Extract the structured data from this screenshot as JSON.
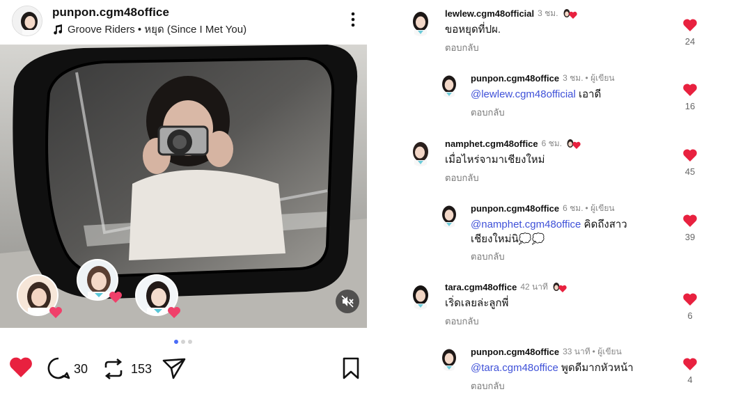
{
  "post": {
    "username": "punpon.cgm48office",
    "music": "Groove Riders • หยุด (Since I Met You)",
    "icons": {
      "music": "music-note-icon",
      "more": "more-vertical-icon",
      "mute": "muted-speaker-icon",
      "like": "heart-filled-icon",
      "comment": "comment-bubble-icon",
      "repost": "repost-icon",
      "share": "paper-plane-icon",
      "save": "bookmark-icon"
    },
    "carousel": {
      "count": 3,
      "active_index": 0
    },
    "like_state": "liked",
    "comment_count": "30",
    "repost_count": "153",
    "colors": {
      "like": "#e8213f",
      "mention": "#3f51d8",
      "dot_active": "#4a6cf7",
      "creator_heart": "#e8213f"
    }
  },
  "comments": [
    {
      "username": "lewlew.cgm48official",
      "time": "3 ชม.",
      "creator_liked": true,
      "text": "ขอหยุดที่ปผ.",
      "reply_label": "ตอบกลับ",
      "likes": "24",
      "is_reply": false
    },
    {
      "username": "punpon.cgm48office",
      "time": "3 ชม.",
      "author_label": "• ผู้เขียน",
      "mention": "@lewlew.cgm48official",
      "text": " เอาดี",
      "reply_label": "ตอบกลับ",
      "likes": "16",
      "is_reply": true
    },
    {
      "username": "namphet.cgm48office",
      "time": "6 ชม.",
      "creator_liked": true,
      "text": "เมื่อไหร่จามาเชียงใหม่",
      "reply_label": "ตอบกลับ",
      "likes": "45",
      "is_reply": false
    },
    {
      "username": "punpon.cgm48office",
      "time": "6 ชม.",
      "author_label": "• ผู้เขียน",
      "mention": "@namphet.cgm48office",
      "text": " คิดถึงสาว",
      "text2": "เชียงใหม่นิ💭💭",
      "reply_label": "ตอบกลับ",
      "likes": "39",
      "is_reply": true
    },
    {
      "username": "tara.cgm48office",
      "time": "42 นาที",
      "creator_liked": true,
      "text": "เริ่ดเลยล่ะลูกพี่",
      "reply_label": "ตอบกลับ",
      "likes": "6",
      "is_reply": false
    },
    {
      "username": "punpon.cgm48office",
      "time": "33 นาที",
      "author_label": "• ผู้เขียน",
      "mention": "@tara.cgm48office",
      "text": " พูดดีมากหัวหน้า",
      "reply_label": "ตอบกลับ",
      "likes": "4",
      "is_reply": true
    }
  ]
}
